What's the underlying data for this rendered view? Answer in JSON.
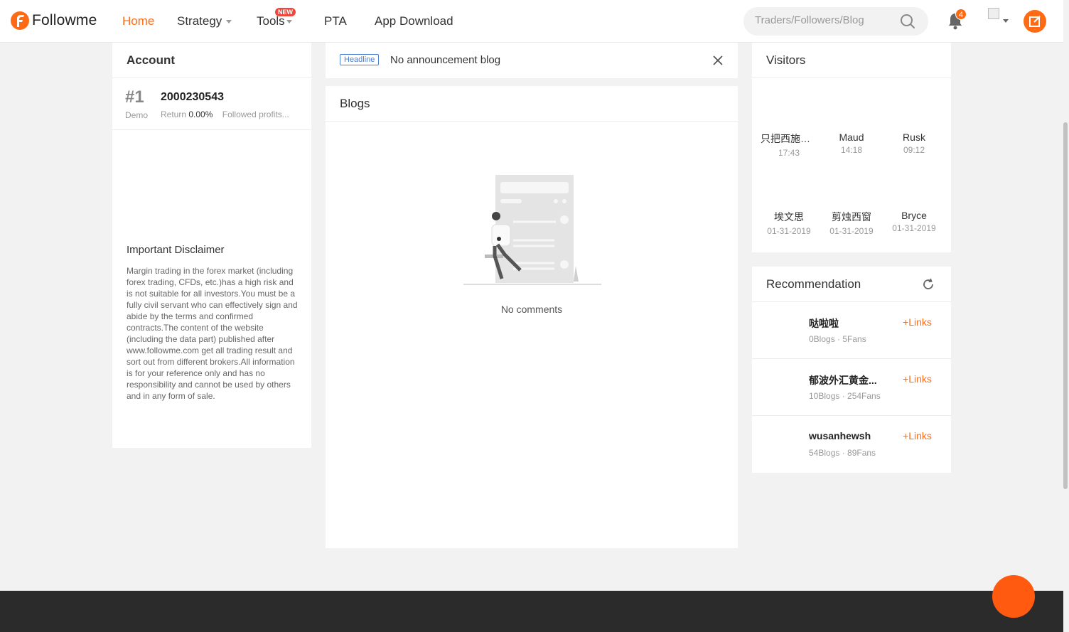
{
  "brand": {
    "name": "Followme",
    "accent": "#ff6a14"
  },
  "nav": {
    "items": [
      {
        "label": "Home",
        "active": true
      },
      {
        "label": "Strategy",
        "dropdown": true
      },
      {
        "label": "Tools",
        "dropdown": true,
        "badge": "NEW"
      },
      {
        "label": "PTA"
      },
      {
        "label": "App Download"
      }
    ]
  },
  "search": {
    "placeholder": "Traders/Followers/Blog",
    "value": ""
  },
  "notifications": {
    "count": "4"
  },
  "account": {
    "title": "Account",
    "rank": "#1",
    "type": "Demo",
    "number": "2000230543",
    "return_label": "Return",
    "return_value": "0.00%",
    "followed": "Followed profits..."
  },
  "disclaimer": {
    "title": "Important Disclaimer",
    "text": "Margin trading in the forex market (including forex trading, CFDs, etc.)has a high risk and is not suitable for all investors.You must be a fully civil servant who can effectively sign and abide by the terms and confirmed contracts.The content of the website (including the data part) published after www.followme.com get all trading result and sort out from different brokers.All information is for your reference only and has no responsibility and cannot be used by others and in any form of sale."
  },
  "headline": {
    "tag": "Headline",
    "text": "No announcement blog"
  },
  "blogs": {
    "title": "Blogs",
    "empty_text": "No comments"
  },
  "visitors": {
    "title": "Visitors",
    "items": [
      {
        "name": "只把西施赚...",
        "time": "17:43"
      },
      {
        "name": "Maud",
        "time": "14:18"
      },
      {
        "name": "Rusk",
        "time": "09:12"
      },
      {
        "name": "埃文思",
        "time": "01-31-2019"
      },
      {
        "name": "剪烛西窗",
        "time": "01-31-2019"
      },
      {
        "name": "Bryce",
        "time": "01-31-2019"
      }
    ]
  },
  "recommendation": {
    "title": "Recommendation",
    "link_label": "Links",
    "items": [
      {
        "name": "哒啦啦",
        "meta": "0Blogs · 5Fans"
      },
      {
        "name": "郁波外汇黄金...",
        "meta": "10Blogs · 254Fans"
      },
      {
        "name": "wusanhewsh",
        "meta": "54Blogs · 89Fans"
      }
    ]
  }
}
